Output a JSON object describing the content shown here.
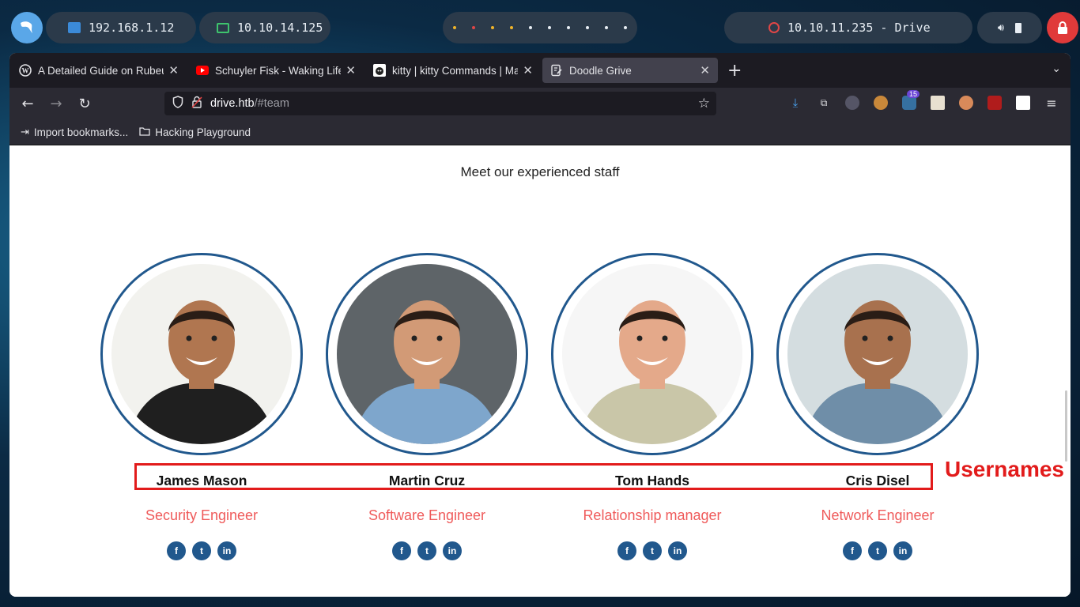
{
  "desktop": {
    "ip_local": "192.168.1.12",
    "ip_vpn": "10.10.14.125",
    "target": "10.10.11.235 - Drive",
    "dot_colors": [
      "#f0b429",
      "#e04646",
      "#f0b429",
      "#f0b429",
      "#e8eef4",
      "#e8eef4",
      "#e8eef4",
      "#e8eef4",
      "#e8eef4",
      "#e8eef4"
    ]
  },
  "tabs": [
    {
      "label": "A Detailed Guide on Rubeus",
      "icon": "wordpress-icon"
    },
    {
      "label": "Schuyler Fisk - Waking Life",
      "icon": "youtube-icon"
    },
    {
      "label": "kitty | kitty Commands | Man",
      "icon": "kitty-icon"
    },
    {
      "label": "Doodle Grive",
      "icon": "page-edit-icon",
      "active": true
    }
  ],
  "url": {
    "host": "drive.htb",
    "path": "/#team"
  },
  "extensions": {
    "badge": "15"
  },
  "bookmarks": [
    {
      "label": "Import bookmarks...",
      "icon": "import-icon"
    },
    {
      "label": "Hacking Playground",
      "icon": "folder-icon"
    }
  ],
  "page": {
    "subtitle": "Meet our experienced staff",
    "team": [
      {
        "name": "James Mason",
        "role": "Security Engineer",
        "shirt": "#1f1f1f",
        "skin": "#b07650",
        "bg": "#f2f2ee"
      },
      {
        "name": "Martin Cruz",
        "role": "Software Engineer",
        "shirt": "#7ea6cc",
        "skin": "#d29a76",
        "bg": "#5e6468"
      },
      {
        "name": "Tom Hands",
        "role": "Relationship manager",
        "shirt": "#c9c6a8",
        "skin": "#e4a98a",
        "bg": "#f6f6f6"
      },
      {
        "name": "Cris Disel",
        "role": "Network Engineer",
        "shirt": "#6f8ea8",
        "skin": "#a8714e",
        "bg": "#d4dde0"
      }
    ],
    "social": {
      "facebook": "f",
      "twitter": "t",
      "linkedin": "in"
    },
    "annotation": "Usernames"
  }
}
